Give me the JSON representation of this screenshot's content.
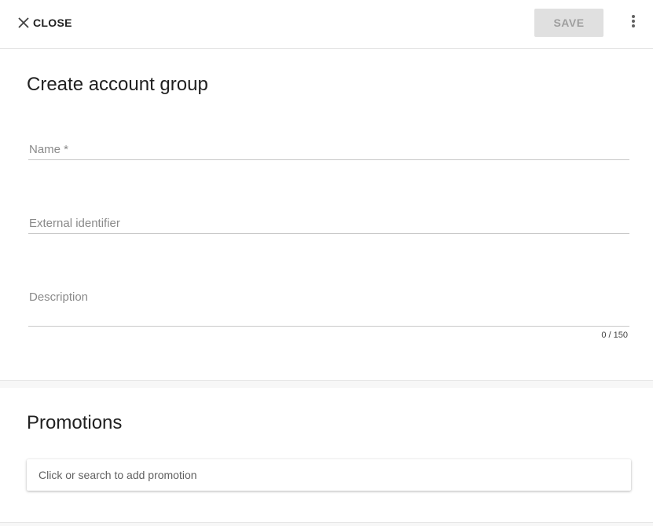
{
  "topbar": {
    "close_label": "CLOSE",
    "close_icon": "close-icon",
    "save_label": "SAVE",
    "more_icon": "more-vert-icon"
  },
  "form": {
    "title": "Create account group",
    "name_label": "Name *",
    "name_value": "",
    "external_id_label": "External identifier",
    "external_id_value": "",
    "description_label": "Description",
    "description_value": "",
    "description_counter": "0 / 150"
  },
  "promotions": {
    "title": "Promotions",
    "search_placeholder": "Click or search to add promotion"
  },
  "colors": {
    "save_disabled_bg": "#e0e0e0",
    "save_disabled_text": "#9e9e9e",
    "label_gray": "#8a8a8a"
  }
}
